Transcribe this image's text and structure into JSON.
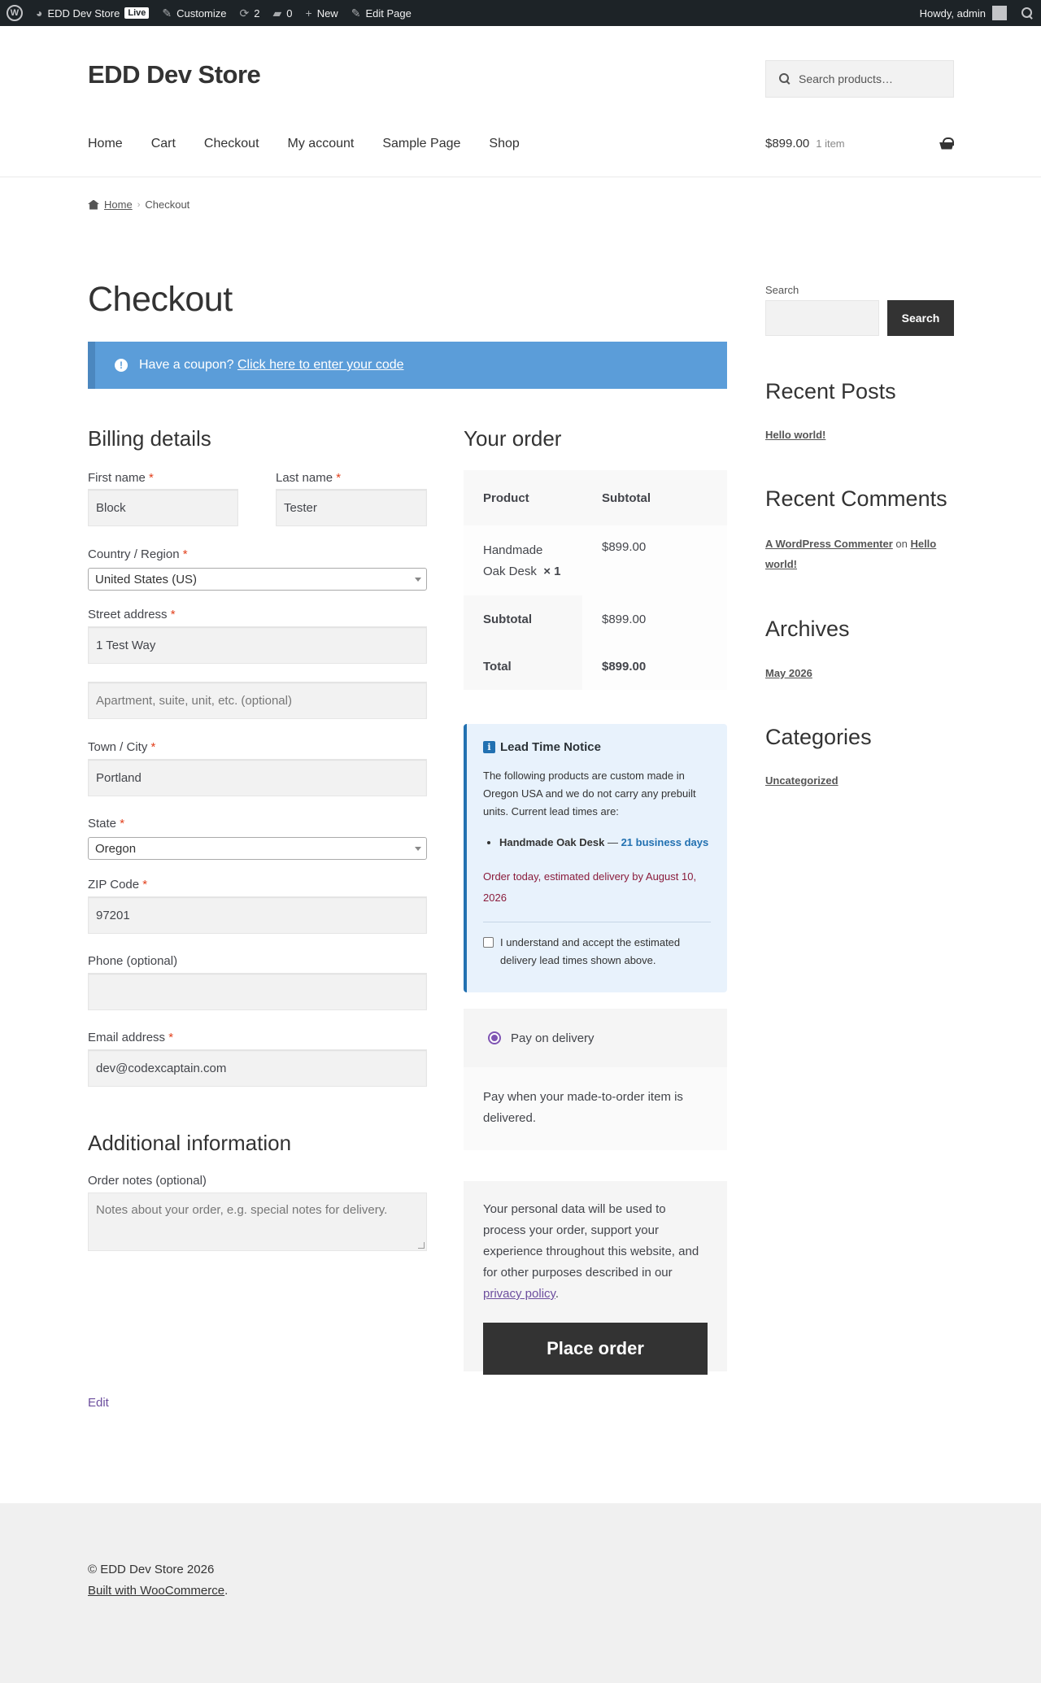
{
  "adminbar": {
    "site_name": "EDD Dev Store",
    "live_badge": "Live",
    "customize": "Customize",
    "updates_count": "2",
    "comments_count": "0",
    "new": "New",
    "edit_page": "Edit Page",
    "howdy": "Howdy, admin"
  },
  "header": {
    "site_title": "EDD Dev Store",
    "search_placeholder": "Search products…",
    "nav": [
      "Home",
      "Cart",
      "Checkout",
      "My account",
      "Sample Page",
      "Shop"
    ],
    "cart_total": "$899.00",
    "cart_count": "1 item"
  },
  "breadcrumb": {
    "home": "Home",
    "current": "Checkout"
  },
  "page": {
    "title": "Checkout",
    "coupon_text": "Have a coupon?",
    "coupon_link": "Click here to enter your code",
    "edit_link": "Edit"
  },
  "billing": {
    "title": "Billing details",
    "first_name_label": "First name",
    "first_name": "Block",
    "last_name_label": "Last name",
    "last_name": "Tester",
    "country_label": "Country / Region",
    "country": "United States (US)",
    "street_label": "Street address",
    "street": "1 Test Way",
    "apartment_placeholder": "Apartment, suite, unit, etc. (optional)",
    "city_label": "Town / City",
    "city": "Portland",
    "state_label": "State",
    "state": "Oregon",
    "zip_label": "ZIP Code",
    "zip": "97201",
    "phone_label": "Phone (optional)",
    "phone": "",
    "email_label": "Email address",
    "email": "dev@codexcaptain.com",
    "required_mark": "*"
  },
  "additional": {
    "title": "Additional information",
    "notes_label": "Order notes (optional)",
    "notes_placeholder": "Notes about your order, e.g. special notes for delivery."
  },
  "order": {
    "title": "Your order",
    "col_product": "Product",
    "col_subtotal": "Subtotal",
    "item_name_line1": "Handmade",
    "item_name_line2": "Oak Desk",
    "item_qty": "× 1",
    "item_price": "$899.00",
    "subtotal_label": "Subtotal",
    "subtotal": "$899.00",
    "total_label": "Total",
    "total": "$899.00"
  },
  "lead_notice": {
    "icon_glyph": "i",
    "title": "Lead Time Notice",
    "body": "The following products are custom made in Oregon USA and we do not carry any prebuilt units. Current lead times are:",
    "item_name": "Handmade Oak Desk",
    "item_dash": " — ",
    "item_days": "21 business days",
    "delivery": "Order today, estimated delivery by August 10, 2026",
    "accept": "I understand and accept the estimated delivery lead times shown above.",
    "accent_color": "#2271b1"
  },
  "payment": {
    "method": "Pay on delivery",
    "description": "Pay when your made-to-order item is delivered."
  },
  "place_order": {
    "privacy_text": "Your personal data will be used to process your order, support your experience throughout this website, and for other purposes described in our",
    "privacy_link": "privacy policy",
    "privacy_end": ".",
    "button": "Place order"
  },
  "sidebar": {
    "search_label": "Search",
    "search_button": "Search",
    "recent_posts_title": "Recent Posts",
    "recent_post": "Hello world!",
    "recent_comments_title": "Recent Comments",
    "comment_author": "A WordPress Commenter",
    "comment_on": " on ",
    "comment_post_line1": "Hello",
    "comment_post_line2": "world!",
    "archives_title": "Archives",
    "archive": "May 2026",
    "categories_title": "Categories",
    "category": "Uncategorized"
  },
  "footer": {
    "copyright": "© EDD Dev Store 2026",
    "built_with": "Built with WooCommerce",
    "built_end": "."
  }
}
